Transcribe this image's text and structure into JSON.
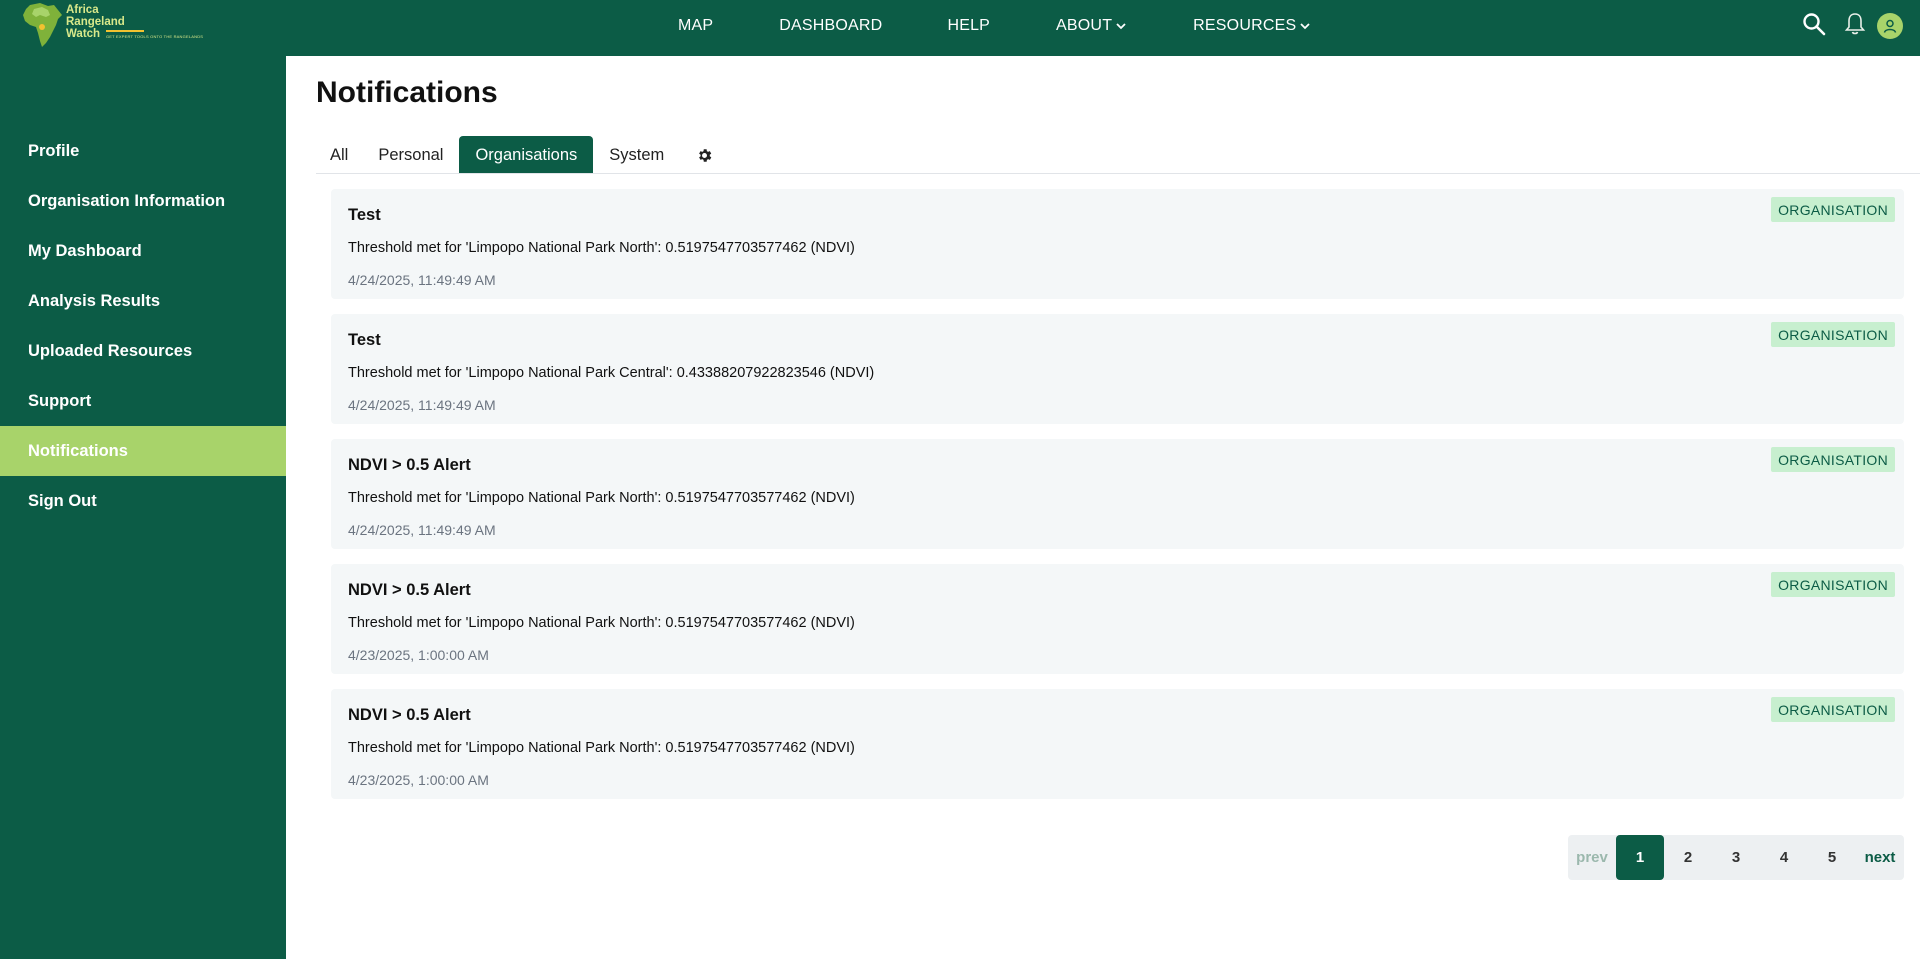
{
  "brand": {
    "name_line1": "Africa",
    "name_line2": "Rangeland",
    "name_line3": "Watch",
    "tagline": "GET EXPERT TOOLS ONTO THE RANGELANDS"
  },
  "nav": {
    "map": "MAP",
    "dashboard": "DASHBOARD",
    "help": "HELP",
    "about": "ABOUT",
    "resources": "RESOURCES"
  },
  "icons": {
    "search": "search-icon",
    "notifications": "bell-icon",
    "user": "user-icon",
    "settings": "gear-icon"
  },
  "colors": {
    "primary": "#0c5c46",
    "accent": "#a8d36a",
    "badge_bg": "#c7efcf"
  },
  "sidebar": {
    "items": [
      {
        "label": "Profile"
      },
      {
        "label": "Organisation Information"
      },
      {
        "label": "My Dashboard"
      },
      {
        "label": "Analysis Results"
      },
      {
        "label": "Uploaded Resources"
      },
      {
        "label": "Support"
      },
      {
        "label": "Notifications",
        "active": true
      },
      {
        "label": "Sign Out"
      }
    ]
  },
  "page": {
    "title": "Notifications"
  },
  "tabs": [
    {
      "label": "All"
    },
    {
      "label": "Personal"
    },
    {
      "label": "Organisations",
      "active": true
    },
    {
      "label": "System"
    }
  ],
  "notifications": [
    {
      "title": "Test",
      "message": "Threshold met for 'Limpopo National Park North': 0.5197547703577462 (NDVI)",
      "time": "4/24/2025, 11:49:49 AM",
      "badge": "ORGANISATION"
    },
    {
      "title": "Test",
      "message": "Threshold met for 'Limpopo National Park Central': 0.43388207922823546 (NDVI)",
      "time": "4/24/2025, 11:49:49 AM",
      "badge": "ORGANISATION"
    },
    {
      "title": "NDVI > 0.5 Alert",
      "message": "Threshold met for 'Limpopo National Park North': 0.5197547703577462 (NDVI)",
      "time": "4/24/2025, 11:49:49 AM",
      "badge": "ORGANISATION"
    },
    {
      "title": "NDVI > 0.5 Alert",
      "message": "Threshold met for 'Limpopo National Park North': 0.5197547703577462 (NDVI)",
      "time": "4/23/2025, 1:00:00 AM",
      "badge": "ORGANISATION"
    },
    {
      "title": "NDVI > 0.5 Alert",
      "message": "Threshold met for 'Limpopo National Park North': 0.5197547703577462 (NDVI)",
      "time": "4/23/2025, 1:00:00 AM",
      "badge": "ORGANISATION"
    }
  ],
  "pagination": {
    "prev": "prev",
    "pages": [
      "1",
      "2",
      "3",
      "4",
      "5"
    ],
    "current": "1",
    "next": "next"
  }
}
